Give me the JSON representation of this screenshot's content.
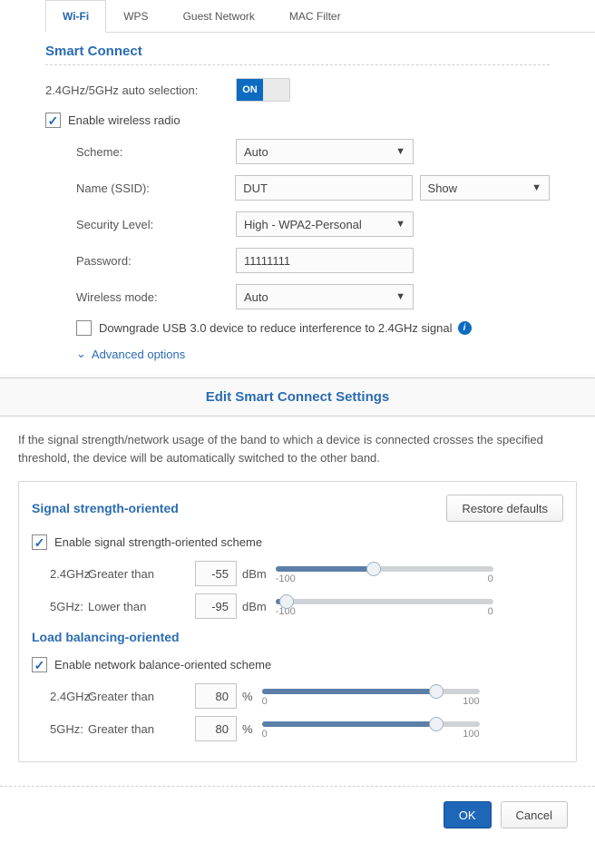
{
  "tabs": [
    "Wi-Fi",
    "WPS",
    "Guest Network",
    "MAC Filter"
  ],
  "active_tab": 0,
  "smart_connect": {
    "title": "Smart Connect",
    "auto_select_label": "2.4GHz/5GHz auto selection:",
    "toggle_on_text": "ON",
    "enable_radio_label": "Enable wireless radio",
    "scheme_label": "Scheme:",
    "scheme_value": "Auto",
    "ssid_label": "Name (SSID):",
    "ssid_value": "DUT",
    "ssid_show_value": "Show",
    "security_label": "Security Level:",
    "security_value": "High - WPA2-Personal",
    "password_label": "Password:",
    "password_value": "11111111",
    "mode_label": "Wireless mode:",
    "mode_value": "Auto",
    "downgrade_label": "Downgrade USB 3.0 device to reduce interference to 2.4GHz signal",
    "advanced_label": "Advanced options"
  },
  "modal": {
    "title": "Edit Smart Connect Settings",
    "description": "If the signal strength/network usage of the band to which a device is connected crosses the specified threshold, the device will be automatically switched to the other band.",
    "restore_label": "Restore defaults",
    "signal_title": "Signal strength-oriented",
    "signal_enable_label": "Enable signal strength-oriented scheme",
    "signal_24_label1": "2.4GHz:",
    "signal_24_label2": "Greater than",
    "signal_24_value": "-55",
    "signal_5_label1": "5GHz:",
    "signal_5_label2": "Lower than",
    "signal_5_value": "-95",
    "signal_unit": "dBm",
    "signal_range_min": "-100",
    "signal_range_max": "0",
    "load_title": "Load balancing-oriented",
    "load_enable_label": "Enable network balance-oriented scheme",
    "load_24_label1": "2.4GHz:",
    "load_24_label2": "Greater than",
    "load_24_value": "80",
    "load_5_label1": "5GHz:",
    "load_5_label2": "Greater than",
    "load_5_value": "80",
    "load_unit": "%",
    "load_range_min": "0",
    "load_range_max": "100",
    "ok_label": "OK",
    "cancel_label": "Cancel"
  }
}
